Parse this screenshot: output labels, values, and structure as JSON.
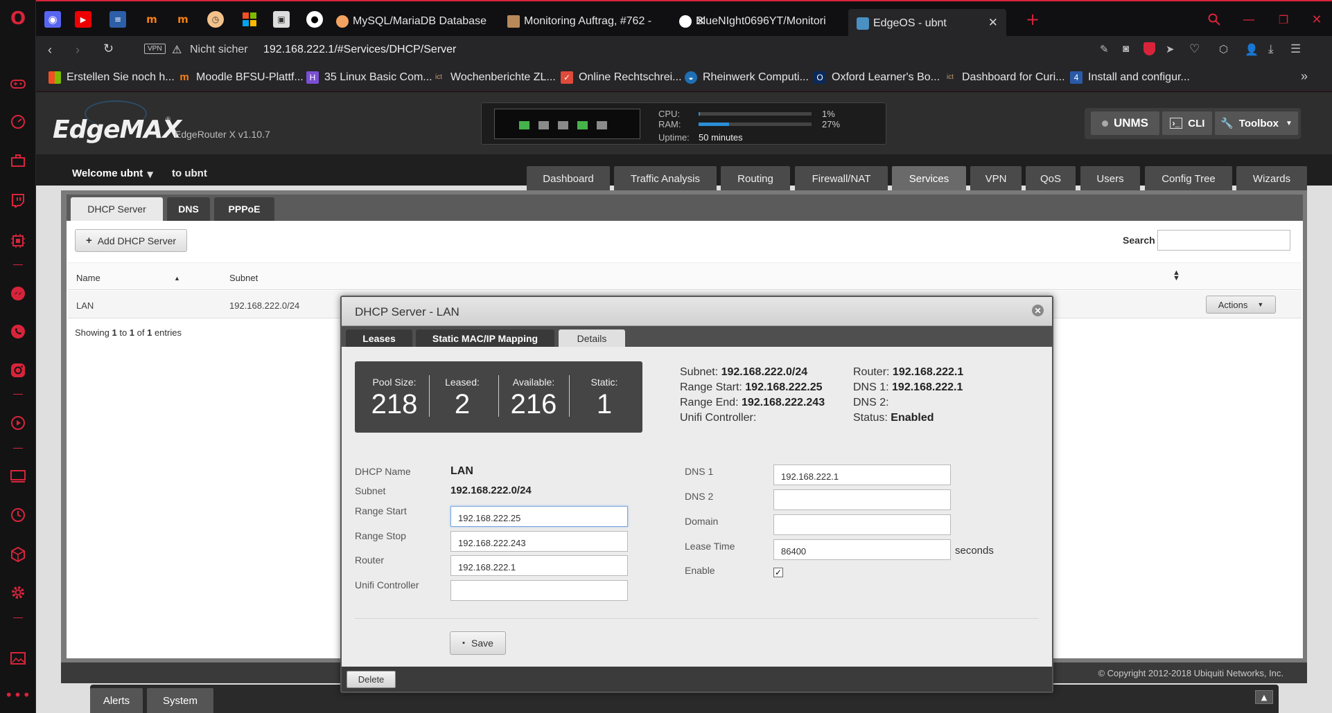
{
  "browser": {
    "tabs": [
      {
        "label": "MySQL/MariaDB Database",
        "icon": "phpmyadmin-icon"
      },
      {
        "label": "Monitoring Auftrag, #762 -",
        "icon": "ict-icon"
      },
      {
        "label": "BlueNIght0696YT/Monitori",
        "icon": "github-icon"
      },
      {
        "label": "EdgeOS - ubnt",
        "icon": "edgeos-icon"
      }
    ],
    "url_warning": "Nicht sicher",
    "url": "192.168.222.1/#Services/DHCP/Server",
    "vpn_badge": "VPN",
    "bookmarks": [
      "Erstellen Sie noch h...",
      "Moodle BFSU-Plattf...",
      "35 Linux Basic Com...",
      "Wochenberichte ZL...",
      "Online Rechtschrei...",
      "Rheinwerk Computi...",
      "Oxford Learner's Bo...",
      "Dashboard for Curi...",
      "Install and configur..."
    ],
    "accent": "#d8243a"
  },
  "header": {
    "logo": "EdgeMAX",
    "device": "EdgeRouter X v1.10.7",
    "cpu_label": "CPU:",
    "ram_label": "RAM:",
    "uptime_label": "Uptime:",
    "cpu_value": "1%",
    "ram_value": "27%",
    "cpu_percent": 1,
    "ram_percent": 27,
    "uptime": "50 minutes",
    "unms": "UNMS",
    "cli": "CLI",
    "toolbox": "Toolbox"
  },
  "nav": {
    "welcome": "Welcome ubnt",
    "to_user": "to ubnt",
    "tabs": [
      "Dashboard",
      "Traffic Analysis",
      "Routing",
      "Firewall/NAT",
      "Services",
      "VPN",
      "QoS",
      "Users",
      "Config Tree",
      "Wizards"
    ],
    "active": "Services"
  },
  "services": {
    "subtabs": [
      "DHCP Server",
      "DNS",
      "PPPoE"
    ],
    "add_button": "Add DHCP Server",
    "search_label": "Search",
    "columns": [
      "Name",
      "Subnet"
    ],
    "rows": [
      {
        "name": "LAN",
        "subnet": "192.168.222.0/24"
      }
    ],
    "actions": "Actions",
    "showing": {
      "prefix": "Showing ",
      "from": "1",
      "to_word": " to ",
      "to": "1",
      "of_word": " of ",
      "total": "1",
      "suffix": " entries"
    }
  },
  "modal": {
    "title": "DHCP Server - LAN",
    "tabs": [
      "Leases",
      "Static MAC/IP Mapping",
      "Details"
    ],
    "active_tab": "Details",
    "pool": {
      "size_label": "Pool Size:",
      "size": "218",
      "leased_label": "Leased:",
      "leased": "2",
      "available_label": "Available:",
      "available": "216",
      "static_label": "Static:",
      "static": "1"
    },
    "summary": {
      "subnet_label": "Subnet:",
      "subnet": "192.168.222.0/24",
      "range_start_label": "Range Start:",
      "range_start": "192.168.222.25",
      "range_end_label": "Range End:",
      "range_end": "192.168.222.243",
      "unifi_label": "Unifi Controller:",
      "unifi": "",
      "router_label": "Router:",
      "router": "192.168.222.1",
      "dns1_label": "DNS 1:",
      "dns1": "192.168.222.1",
      "dns2_label": "DNS 2:",
      "dns2": "",
      "status_label": "Status:",
      "status": "Enabled"
    },
    "form": {
      "dhcp_name_label": "DHCP Name",
      "dhcp_name": "LAN",
      "subnet_label": "Subnet",
      "subnet": "192.168.222.0/24",
      "range_start_label": "Range Start",
      "range_start": "192.168.222.25",
      "range_stop_label": "Range Stop",
      "range_stop": "192.168.222.243",
      "router_label": "Router",
      "router": "192.168.222.1",
      "unifi_label": "Unifi Controller",
      "unifi": "",
      "dns1_label": "DNS 1",
      "dns1": "192.168.222.1",
      "dns2_label": "DNS 2",
      "dns2": "",
      "domain_label": "Domain",
      "domain": "",
      "lease_label": "Lease Time",
      "lease": "86400",
      "lease_unit": "seconds",
      "enable_label": "Enable",
      "enable": true
    },
    "save": "Save",
    "delete": "Delete"
  },
  "footer": {
    "copyright": "© Copyright 2012-2018 Ubiquiti Networks, Inc.",
    "alerts": "Alerts",
    "system": "System"
  }
}
